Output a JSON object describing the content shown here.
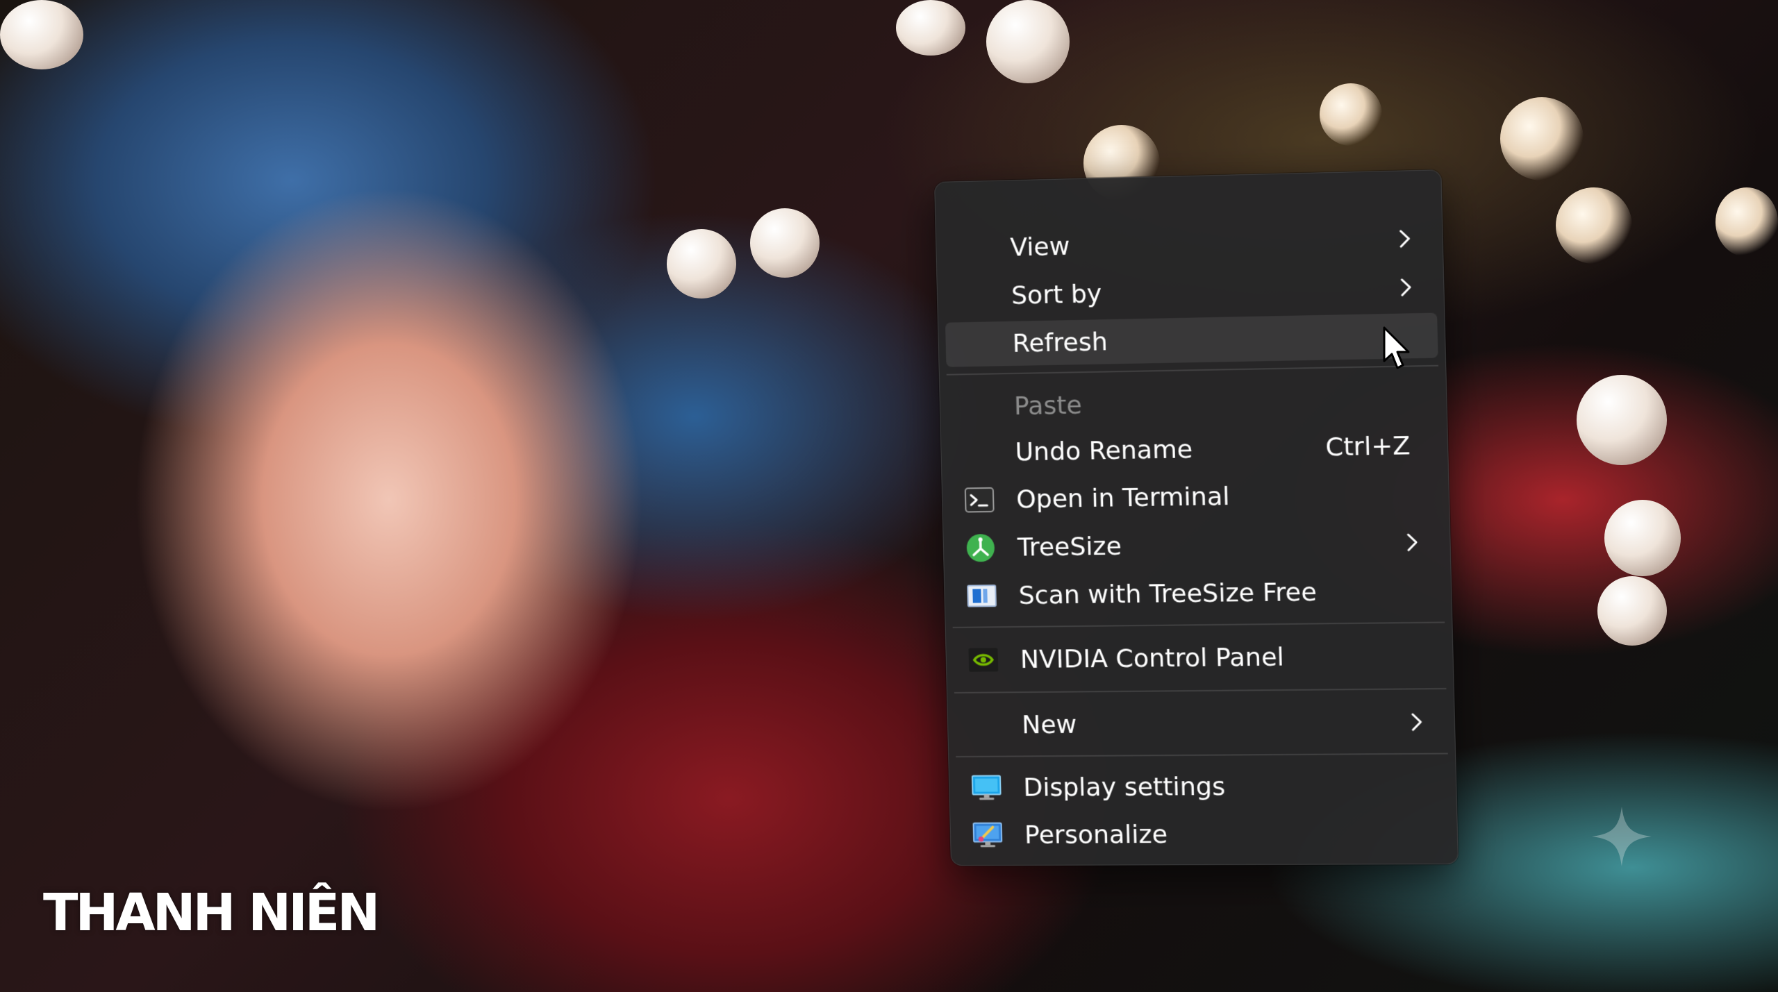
{
  "watermark": {
    "text": "THANH NIÊN"
  },
  "context_menu": {
    "items": [
      {
        "id": "view",
        "label": "View",
        "has_submenu": true
      },
      {
        "id": "sort-by",
        "label": "Sort by",
        "has_submenu": true
      },
      {
        "id": "refresh",
        "label": "Refresh",
        "hovered": true
      },
      {
        "id": "paste",
        "label": "Paste",
        "disabled": true
      },
      {
        "id": "undo-rename",
        "label": "Undo Rename",
        "shortcut": "Ctrl+Z"
      },
      {
        "id": "open-in-terminal",
        "label": "Open in Terminal",
        "icon": "terminal-icon"
      },
      {
        "id": "treesize",
        "label": "TreeSize",
        "icon": "treesize-icon",
        "has_submenu": true
      },
      {
        "id": "scan-with-treesize",
        "label": "Scan with TreeSize Free",
        "icon": "treesize-scan-icon"
      },
      {
        "id": "nvidia-control-panel",
        "label": "NVIDIA Control Panel",
        "icon": "nvidia-icon"
      },
      {
        "id": "new",
        "label": "New",
        "has_submenu": true
      },
      {
        "id": "display-settings",
        "label": "Display settings",
        "icon": "display-icon"
      },
      {
        "id": "personalize",
        "label": "Personalize",
        "icon": "personalize-icon"
      }
    ]
  },
  "colors": {
    "menu_background": "#262628",
    "text": "#ffffff",
    "disabled_text": "#8c8c8c",
    "treesize_green": "#3fb24f",
    "nvidia_green": "#76b900",
    "display_blue": "#1aa3e8"
  }
}
